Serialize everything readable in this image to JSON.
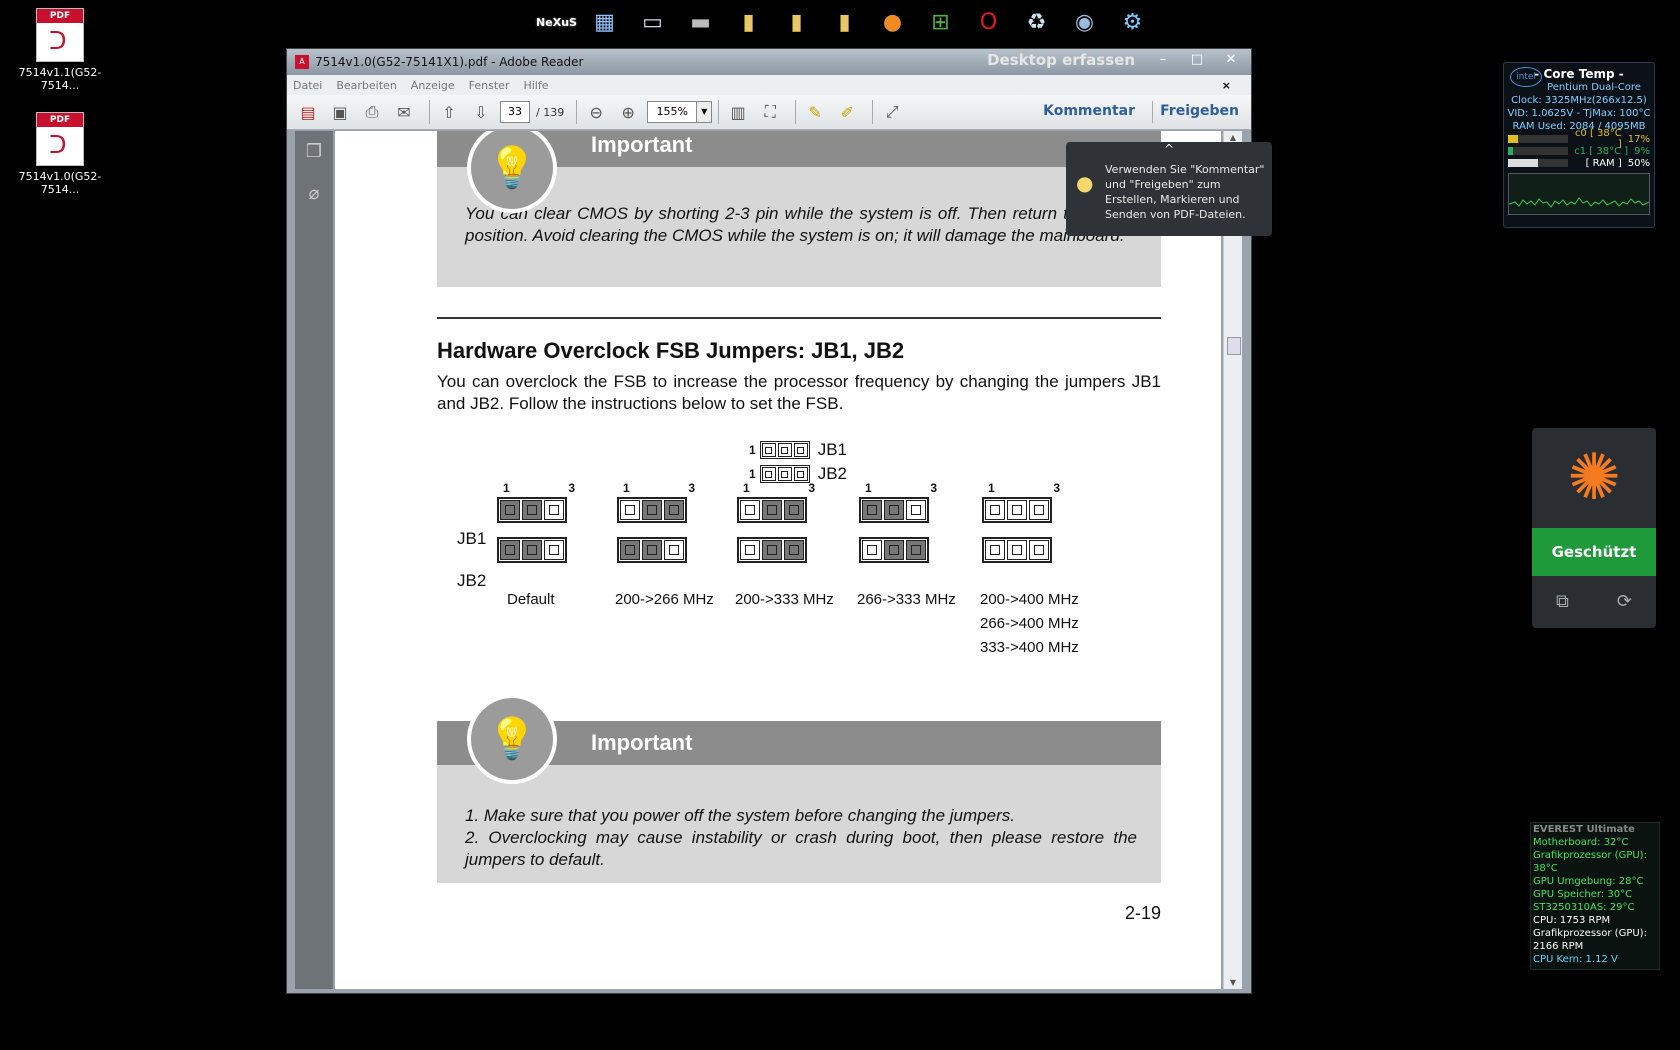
{
  "desktop": {
    "icons": [
      {
        "label": "7514v1.1(G52-7514...",
        "tag": "PDF"
      },
      {
        "label": "7514v1.0(G52-7514...",
        "tag": "PDF"
      }
    ]
  },
  "dock": {
    "items": [
      "nexus-icon",
      "windows-explorer-icon",
      "computer-icon",
      "drive-icon",
      "folder-icon",
      "folder-icon",
      "folder-icon",
      "firefox-icon",
      "windows-icon",
      "opera-icon",
      "recycle-bin-icon",
      "globe-icon",
      "settings-icon"
    ],
    "nexus_label": "NeXuS"
  },
  "window": {
    "title": "7514v1.0(G52-75141X1).pdf - Adobe Reader",
    "capture_label": "Desktop erfassen",
    "minimize": "–",
    "maximize": "□",
    "close": "✕"
  },
  "menu": [
    "Datei",
    "Bearbeiten",
    "Anzeige",
    "Fenster",
    "Hilfe"
  ],
  "toolbar": {
    "page_current": "33",
    "page_total": "/ 139",
    "zoom": "155%",
    "comment_label": "Kommentar",
    "share_label": "Freigeben"
  },
  "tooltip": {
    "text": "Verwenden Sie \"Kommentar\" und \"Freigeben\" zum Erstellen, Markieren und Senden von PDF-Dateien."
  },
  "page": {
    "important1": {
      "heading": "Important",
      "text": "You can clear CMOS by shorting 2-3 pin while the system is off. Then return to 1-2 pin position. Avoid clearing the CMOS while the system is on; it will damage the mainboard."
    },
    "section_title": "Hardware Overclock FSB Jumpers: JB1, JB2",
    "section_text": "You can overclock the FSB to increase the processor frequency by changing the jumpers JB1 and JB2. Follow the instructions below to set the FSB.",
    "legend": {
      "pin_one": "1",
      "jb1": "JB1",
      "jb2": "JB2"
    },
    "row_labels": {
      "jb1": "JB1",
      "jb2": "JB2"
    },
    "pin_numbers": {
      "first": "1",
      "last": "3"
    },
    "configs": [
      {
        "caption": "Default",
        "jb1": [
          1,
          1,
          0
        ],
        "jb2": [
          1,
          1,
          0
        ]
      },
      {
        "caption": "200->266 MHz",
        "jb1": [
          0,
          1,
          1
        ],
        "jb2": [
          1,
          1,
          0
        ]
      },
      {
        "caption": "200->333 MHz",
        "jb1": [
          0,
          1,
          1
        ],
        "jb2": [
          0,
          1,
          1
        ]
      },
      {
        "caption": "266->333 MHz",
        "jb1": [
          1,
          1,
          0
        ],
        "jb2": [
          0,
          1,
          1
        ]
      },
      {
        "caption": "200->400 MHz",
        "caption2": "266->400 MHz",
        "caption3": "333->400 MHz",
        "jb1": [
          0,
          0,
          0
        ],
        "jb2": [
          0,
          0,
          0
        ]
      }
    ],
    "important2": {
      "heading": "Important",
      "item1": "1. Make sure that you power off the system before changing the jumpers.",
      "item2": "2. Overclocking may cause instability or crash during boot, then please restore the jumpers to default."
    },
    "page_number": "2-19"
  },
  "coretemp": {
    "title": "- Core Temp -",
    "cpu": "Pentium Dual-Core",
    "clock": "Clock: 3325MHz(266x12.5)",
    "vid": "VID: 1.0625V - TjMax: 100°C",
    "ram": "RAM Used: 2084 / 4095MB",
    "cores": [
      {
        "label": "c0 [ 38°C ]",
        "load": "17%",
        "fill": 0.17
      },
      {
        "label": "c1 [ 38°C ]",
        "load": "9%",
        "fill": 0.09
      },
      {
        "label": "[ RAM ]",
        "load": "50%",
        "fill": 0.5
      }
    ],
    "brand": "intel"
  },
  "avast": {
    "status": "Geschützt"
  },
  "everest": {
    "title": "EVEREST Ultimate",
    "items": [
      "Motherboard: 32°C",
      "Grafikprozessor (GPU): 38°C",
      "GPU Umgebung: 28°C",
      "GPU Speicher: 30°C",
      "ST3250310AS: 29°C",
      "CPU: 1753 RPM",
      "Grafikprozessor (GPU): 2166 RPM",
      "CPU Kern: 1.12 V"
    ]
  }
}
